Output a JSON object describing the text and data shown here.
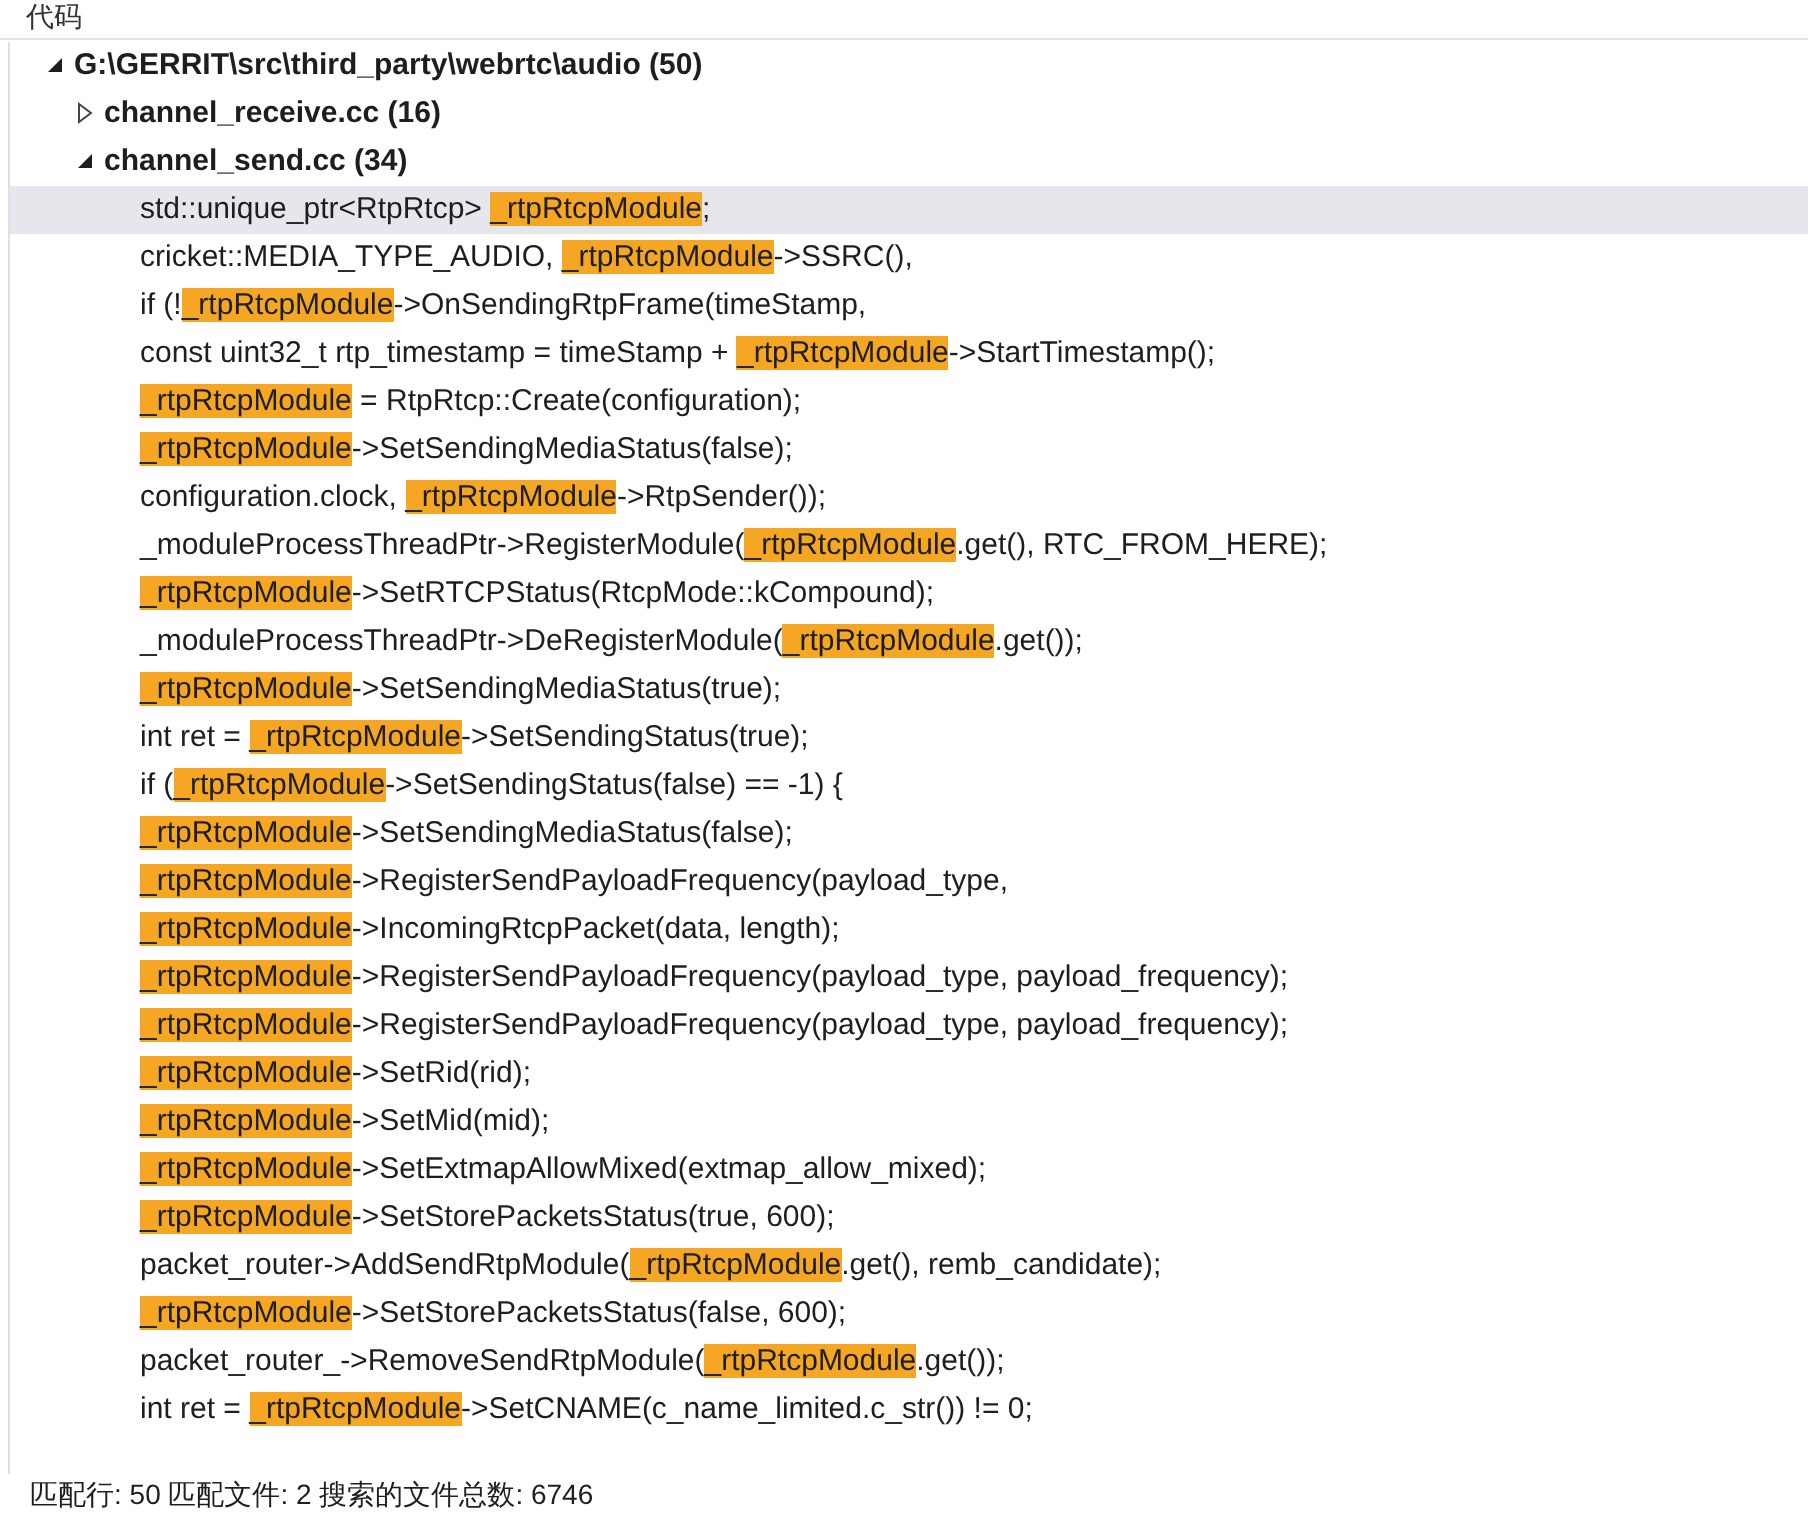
{
  "panel": {
    "title": "代码"
  },
  "tree": [
    {
      "label": "G:\\GERRIT\\src\\third_party\\webrtc\\audio",
      "count": "(50)",
      "expanded": true,
      "children": [
        {
          "label": "channel_receive.cc",
          "count": "(16)",
          "expanded": false
        },
        {
          "label": "channel_send.cc",
          "count": "(34)",
          "expanded": true,
          "results": [
            {
              "before": "std::unique_ptr<RtpRtcp> ",
              "match": "_rtpRtcpModule",
              "after": ";",
              "selected": true
            },
            {
              "before": "cricket::MEDIA_TYPE_AUDIO, ",
              "match": "_rtpRtcpModule",
              "after": "->SSRC(),",
              "selected": false
            },
            {
              "before": "if (!",
              "match": "_rtpRtcpModule",
              "after": "->OnSendingRtpFrame(timeStamp,",
              "selected": false
            },
            {
              "before": "const uint32_t rtp_timestamp = timeStamp + ",
              "match": "_rtpRtcpModule",
              "after": "->StartTimestamp();",
              "selected": false
            },
            {
              "match": "_rtpRtcpModule",
              "after": " = RtpRtcp::Create(configuration);",
              "selected": false
            },
            {
              "match": "_rtpRtcpModule",
              "after": "->SetSendingMediaStatus(false);",
              "selected": false
            },
            {
              "before": "configuration.clock, ",
              "match": "_rtpRtcpModule",
              "after": "->RtpSender());",
              "selected": false
            },
            {
              "before": "_moduleProcessThreadPtr->RegisterModule(",
              "match": "_rtpRtcpModule",
              "after": ".get(), RTC_FROM_HERE);",
              "selected": false
            },
            {
              "match": "_rtpRtcpModule",
              "after": "->SetRTCPStatus(RtcpMode::kCompound);",
              "selected": false
            },
            {
              "before": "_moduleProcessThreadPtr->DeRegisterModule(",
              "match": "_rtpRtcpModule",
              "after": ".get());",
              "selected": false
            },
            {
              "match": "_rtpRtcpModule",
              "after": "->SetSendingMediaStatus(true);",
              "selected": false
            },
            {
              "before": "int ret = ",
              "match": "_rtpRtcpModule",
              "after": "->SetSendingStatus(true);",
              "selected": false
            },
            {
              "before": "if (",
              "match": "_rtpRtcpModule",
              "after": "->SetSendingStatus(false) == -1) {",
              "selected": false
            },
            {
              "match": "_rtpRtcpModule",
              "after": "->SetSendingMediaStatus(false);",
              "selected": false
            },
            {
              "match": "_rtpRtcpModule",
              "after": "->RegisterSendPayloadFrequency(payload_type,",
              "selected": false
            },
            {
              "match": "_rtpRtcpModule",
              "after": "->IncomingRtcpPacket(data, length);",
              "selected": false
            },
            {
              "match": "_rtpRtcpModule",
              "after": "->RegisterSendPayloadFrequency(payload_type, payload_frequency);",
              "selected": false
            },
            {
              "match": "_rtpRtcpModule",
              "after": "->RegisterSendPayloadFrequency(payload_type, payload_frequency);",
              "selected": false
            },
            {
              "match": "_rtpRtcpModule",
              "after": "->SetRid(rid);",
              "selected": false
            },
            {
              "match": "_rtpRtcpModule",
              "after": "->SetMid(mid);",
              "selected": false
            },
            {
              "match": "_rtpRtcpModule",
              "after": "->SetExtmapAllowMixed(extmap_allow_mixed);",
              "selected": false
            },
            {
              "match": "_rtpRtcpModule",
              "after": "->SetStorePacketsStatus(true, 600);",
              "selected": false
            },
            {
              "before": "packet_router->AddSendRtpModule(",
              "match": "_rtpRtcpModule",
              "after": ".get(), remb_candidate);",
              "selected": false
            },
            {
              "match": "_rtpRtcpModule",
              "after": "->SetStorePacketsStatus(false, 600);",
              "selected": false
            },
            {
              "before": "packet_router_->RemoveSendRtpModule(",
              "match": "_rtpRtcpModule",
              "after": ".get());",
              "selected": false
            },
            {
              "before": "int ret = ",
              "match": "_rtpRtcpModule",
              "after": "->SetCNAME(c_name_limited.c_str()) != 0;",
              "selected": false
            }
          ]
        }
      ]
    }
  ],
  "status_bar": "匹配行: 50 匹配文件: 2 搜索的文件总数: 6746"
}
